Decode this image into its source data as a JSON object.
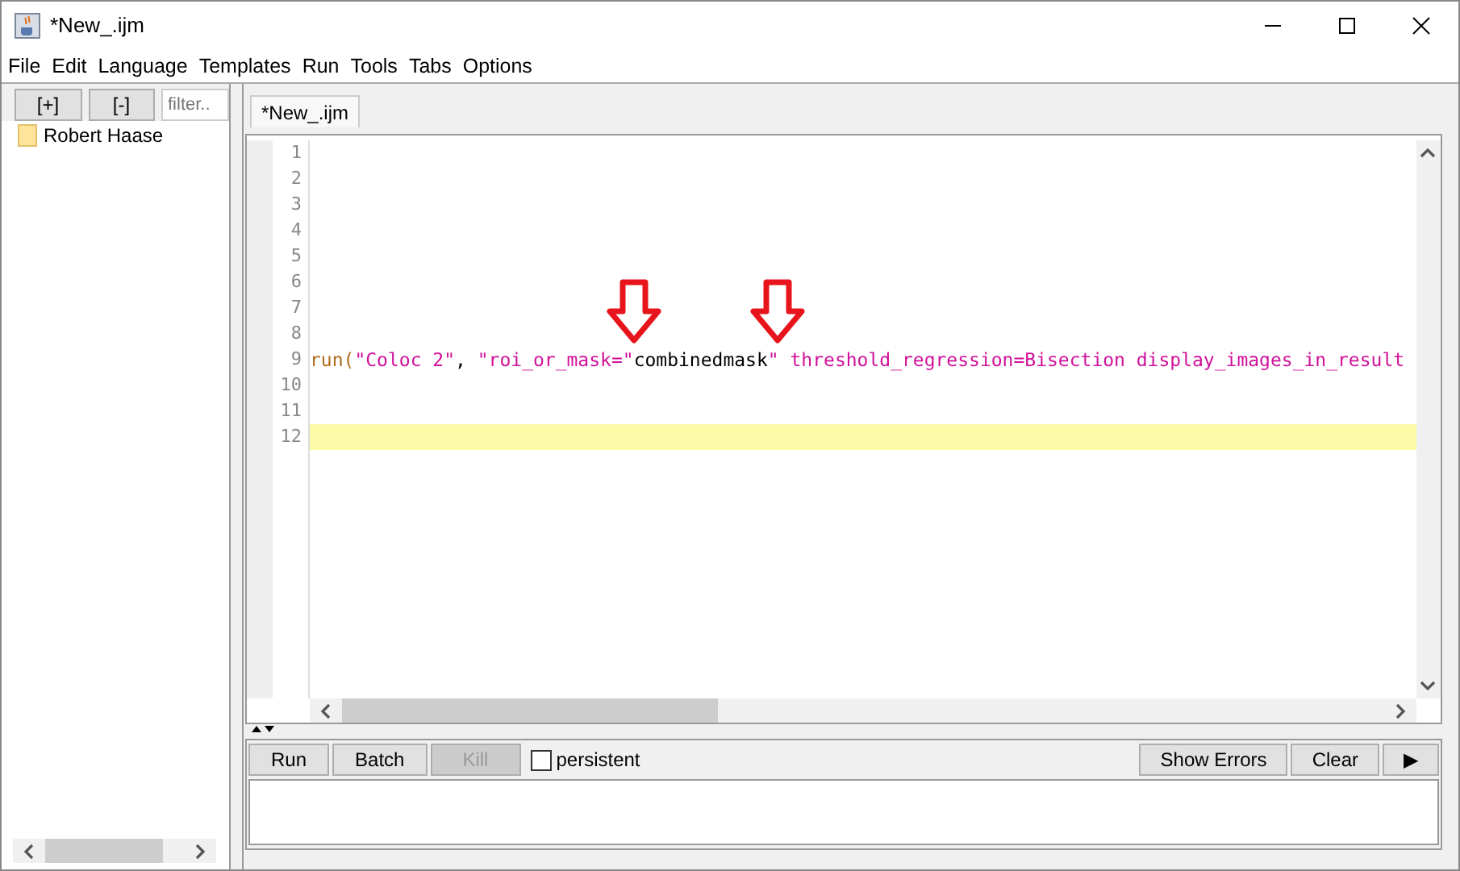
{
  "window": {
    "title": "*New_.ijm"
  },
  "menu": [
    "File",
    "Edit",
    "Language",
    "Templates",
    "Run",
    "Tools",
    "Tabs",
    "Options"
  ],
  "sidebar": {
    "buttons": [
      "[+]",
      "[-]"
    ],
    "filter": {
      "placeholder": "filter.."
    },
    "items": [
      {
        "label": "Robert Haase"
      }
    ]
  },
  "tabs": [
    {
      "label": "*New_.ijm",
      "selected": true
    }
  ],
  "editor": {
    "lines": [
      {
        "number": "1",
        "current": false
      },
      {
        "number": "2",
        "current": false
      },
      {
        "number": "3",
        "current": false
      },
      {
        "number": "4",
        "current": false
      },
      {
        "number": "5",
        "current": false
      },
      {
        "number": "6",
        "current": false
      },
      {
        "number": "7",
        "current": false
      },
      {
        "number": "8",
        "current": false
      },
      {
        "number": "9",
        "current": false,
        "tokens": [
          {
            "kind": "function",
            "text": "run("
          },
          {
            "kind": "string",
            "text": "\"Coloc 2\""
          },
          {
            "kind": "plain",
            "text": ", "
          },
          {
            "kind": "string",
            "text": "\"roi_or_mask=\""
          },
          {
            "kind": "plain",
            "text": "combinedmask"
          },
          {
            "kind": "string",
            "text": "\" threshold_regression=Bisection display_images_in_result"
          }
        ]
      },
      {
        "number": "10",
        "current": false
      },
      {
        "number": "11",
        "current": false
      },
      {
        "number": "12",
        "current": true
      }
    ]
  },
  "toolbar": [
    {
      "label": "Run",
      "disabled": false
    },
    {
      "label": "Batch",
      "disabled": false
    },
    {
      "label": "Kill",
      "disabled": true
    }
  ],
  "persistent": {
    "label": "persistent",
    "checked": false
  },
  "right_buttons": [
    "Show Errors",
    "Clear",
    "▶"
  ]
}
